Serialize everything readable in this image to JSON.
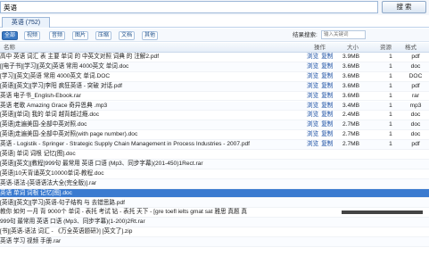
{
  "search": {
    "value": "英语",
    "button_label": "搜 索"
  },
  "tabs": [
    {
      "label": "英语 (752)"
    }
  ],
  "filters": {
    "buttons": [
      "全部",
      "视频",
      "音频",
      "图片",
      "压缩",
      "文档",
      "其他"
    ],
    "active_index": 0,
    "result_filter_label": "结果搜索:",
    "result_filter_placeholder": "输入关键词"
  },
  "columns": {
    "name": "名称",
    "ops": "操作",
    "size": "大小",
    "resources": "资源",
    "format": "格式"
  },
  "ops": {
    "browse": "浏览",
    "copy": "复制"
  },
  "rows": [
    {
      "name": "高中 英语 词汇 表 主要 单词 的 中英文对照 词典 的 注解2.pdf",
      "size": "3.9MB",
      "res": "1",
      "fmt": "pdf"
    },
    {
      "name": "[[电子书][学习][英文]英语 常用 4000英文 单词.doc",
      "size": "3.6MB",
      "res": "1",
      "fmt": "doc"
    },
    {
      "name": "[学习][英文]英语 常用 4000英文 单词.DOC",
      "size": "3.6MB",
      "res": "1",
      "fmt": "DOC"
    },
    {
      "name": "[英语][英文][学习]李阳 疯狂英语 - 突破 对话.pdf",
      "size": "3.6MB",
      "res": "1",
      "fmt": "pdf"
    },
    {
      "name": "英语 电子书_English-Ebook.rar",
      "size": "3.6MB",
      "res": "1",
      "fmt": "rar"
    },
    {
      "name": "英语 老歌 Amazing Grace 奇异恩典 .mp3",
      "size": "3.4MB",
      "res": "1",
      "fmt": "mp3"
    },
    {
      "name": "[英语][单词] 我的 单词 越背越过瘾.doc",
      "size": "2.4MB",
      "res": "1",
      "fmt": "doc"
    },
    {
      "name": "[英语]走遍美国-全部中英对照.doc",
      "size": "2.7MB",
      "res": "1",
      "fmt": "doc"
    },
    {
      "name": "[英语]走遍美国-全部中英对照(with page number).doc",
      "size": "2.7MB",
      "res": "1",
      "fmt": "doc"
    },
    {
      "name": "英语 - Logistik - Springer - Strategic Supply Chain Management in Process Industries - 2007.pdf",
      "size": "2.7MB",
      "res": "1",
      "fmt": "pdf"
    },
    {
      "name": "[英语] 单词 词根 记忆[图].doc",
      "wide": true
    },
    {
      "name": "[英语][英文][教程]999句 最常用 英语 口语 (Mp3、同步字幕)(201-450)1Rect.rar",
      "wide": true
    },
    {
      "name": "[英语]10天背诵英文10000单词-教程.doc",
      "wide": true
    },
    {
      "name": "英语-语法-[英语语法大全(完全版)].rar",
      "wide": true
    },
    {
      "name": "英语 单词 词根 记忆[图].doc",
      "wide": true,
      "selected": true
    },
    {
      "name": "[英语][英文][学习]英语-句子结构 与 去错思路.pdf",
      "wide": true
    },
    {
      "name": "教你 如何 一月 背 9000个 单词 - 表托 考试 钻 - 表托 天下 - [gre toefl ielts gmat sat 雅思 真题 真",
      "wide": true,
      "progress": 0.35
    },
    {
      "name": "999句 最常用 英语 口语 (Mp3、同步字幕)(1-200)2Rt.rar",
      "wide": true
    },
    {
      "name": "[书][英语-语法 词汇 - 《万全英语题研》] [英文了].zip",
      "wide": true
    },
    {
      "name": "英语 学习 视频 手册.rar",
      "wide": true
    }
  ]
}
